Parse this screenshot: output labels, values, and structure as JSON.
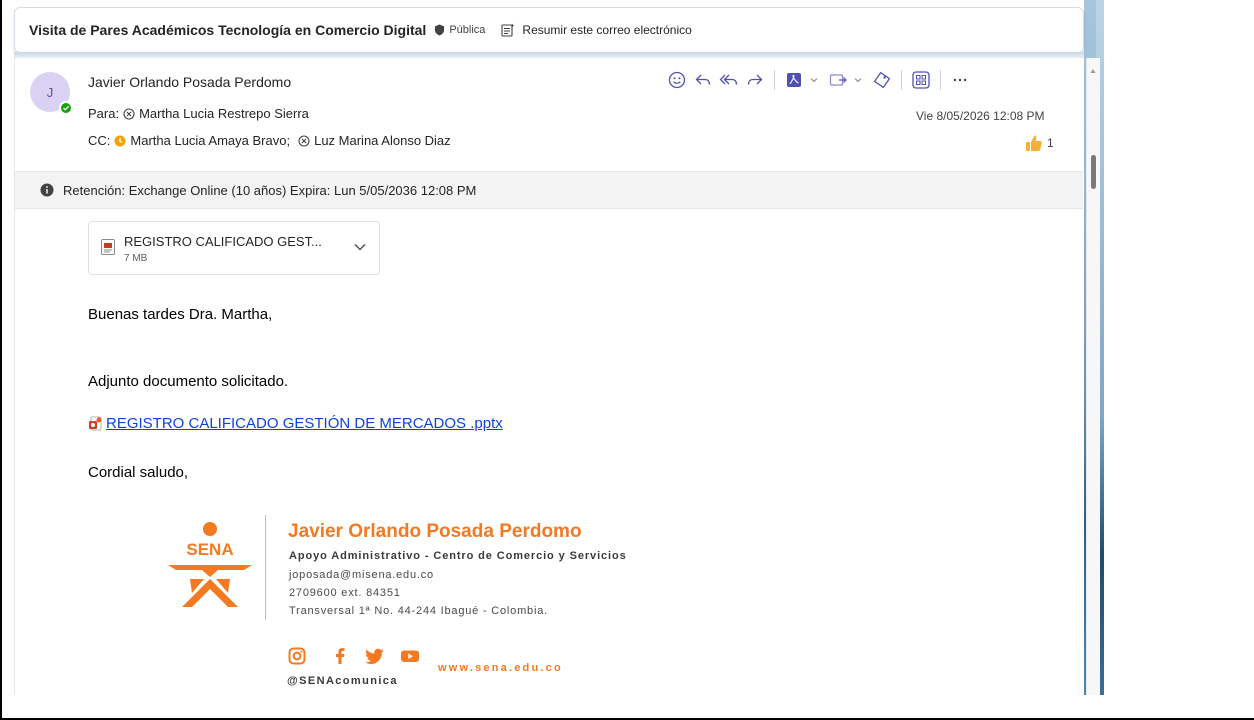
{
  "header": {
    "subject": "Visita de Pares Académicos Tecnología en Comercio Digital",
    "sensitivity": "Pública",
    "summarize_label": "Resumir este correo electrónico"
  },
  "message": {
    "avatar_initial": "J",
    "sender_name": "Javier Orlando Posada Perdomo",
    "to_label": "Para:",
    "to": [
      "Martha Lucia Restrepo Sierra"
    ],
    "cc_label": "CC:",
    "cc": [
      "Martha Lucia Amaya Bravo;",
      "Luz Marina Alonso Diaz"
    ],
    "date": "Vie 8/05/2026 12:08 PM",
    "like_count": "1",
    "toolbar_icons": [
      "emoji-icon",
      "reply-icon",
      "reply-all-icon",
      "forward-icon",
      "pdf-addin-icon",
      "move-icon",
      "tag-icon",
      "apps-icon",
      "more-icon"
    ]
  },
  "retention": {
    "text": "Retención: Exchange Online (10 años) Expira: Lun 5/05/2036 12:08 PM"
  },
  "attachment": {
    "name": "REGISTRO CALIFICADO GEST...",
    "size": "7 MB"
  },
  "body": {
    "greeting": "Buenas tardes Dra. Martha,",
    "line1": "Adjunto documento solicitado.",
    "link_text": "REGISTRO CALIFICADO GESTIÓN DE MERCADOS .pptx",
    "closing": "Cordial saludo,"
  },
  "signature": {
    "logo_text": "SENA",
    "name": "Javier Orlando Posada Perdomo",
    "role": "Apoyo Administrativo - Centro de Comercio y Servicios",
    "email": "joposada@misena.edu.co",
    "phone": "2709600 ext. 84351",
    "address": "Transversal 1ª No. 44-244 Ibagué - Colombia.",
    "website": "www.sena.edu.co",
    "handle": "@SENAcomunica",
    "social_icons": [
      "instagram-icon",
      "facebook-icon",
      "twitter-icon",
      "youtube-icon"
    ]
  },
  "colors": {
    "accent": "#4f52b2",
    "link": "#0b45d6",
    "sena_orange": "#f47920",
    "presence": "#13a10e"
  }
}
